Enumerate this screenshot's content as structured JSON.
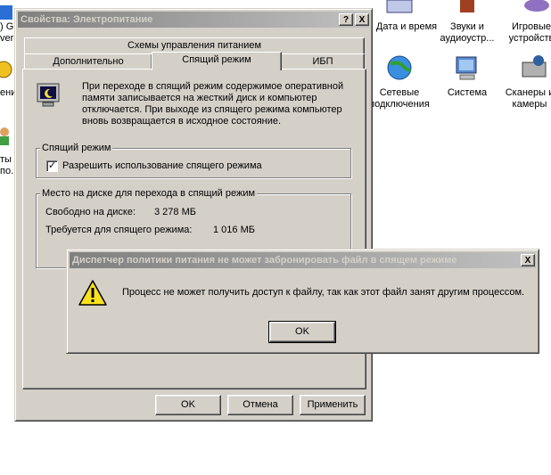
{
  "desktop": {
    "left_fragments": [
      ") Gl",
      "ver",
      "ени",
      "ты",
      "по."
    ],
    "icons": [
      {
        "label": "Дата и время",
        "icon": "clock-icon"
      },
      {
        "label": "Звуки и аудиоустр...",
        "icon": "speaker-icon"
      },
      {
        "label": "Игровые устройств",
        "icon": "gamepad-icon"
      },
      {
        "label": "Сетевые подключения",
        "icon": "network-globe-icon"
      },
      {
        "label": "Система",
        "icon": "computer-icon"
      },
      {
        "label": "Сканеры и камеры",
        "icon": "scanner-camera-icon"
      }
    ]
  },
  "properties_dialog": {
    "title": "Свойства: Электропитание",
    "help_btn": "?",
    "close_btn": "X",
    "tabs_row_back": [
      "Схемы управления питанием"
    ],
    "tabs_row_front": [
      "Дополнительно",
      "Спящий режим",
      "ИБП"
    ],
    "selected_tab": "Спящий режим",
    "description": "При переходе в спящий режим содержимое оперативной памяти записывается на жесткий диск и компьютер отключается. При выходе из спящего режима компьютер вновь возвращается в исходное состояние.",
    "hibernate_group": {
      "legend": "Спящий режим",
      "checkbox_label": "Разрешить использование спящего режима",
      "checked": true
    },
    "disk_group": {
      "legend": "Место на диске для перехода в спящий режим",
      "free_label": "Свободно на диске:",
      "free_value": "3 278 МБ",
      "required_label": "Требуется для спящего режима:",
      "required_value": "1 016 МБ"
    },
    "buttons": {
      "ok": "OK",
      "cancel": "Отмена",
      "apply": "Применить"
    }
  },
  "error_dialog": {
    "title": "Диспетчер политики питания не может забронировать файл в спящем режиме",
    "close_btn": "X",
    "message": "Процесс не может получить доступ к файлу, так как этот файл занят другим процессом.",
    "ok": "OK"
  }
}
